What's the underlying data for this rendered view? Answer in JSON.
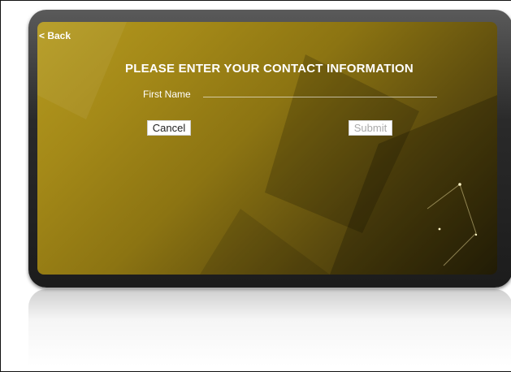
{
  "back": {
    "label": "< Back"
  },
  "form": {
    "title": "PLEASE ENTER YOUR CONTACT INFORMATION",
    "first_name": {
      "label": "First Name",
      "value": "",
      "placeholder": ""
    },
    "cancel_label": "Cancel",
    "submit_label": "Submit"
  },
  "colors": {
    "screen_gold": "#a48918",
    "screen_dark": "#2b2407",
    "bezel": "#2a2a2a",
    "text": "#ffffff",
    "submit_disabled_text": "#aaaaaa"
  }
}
